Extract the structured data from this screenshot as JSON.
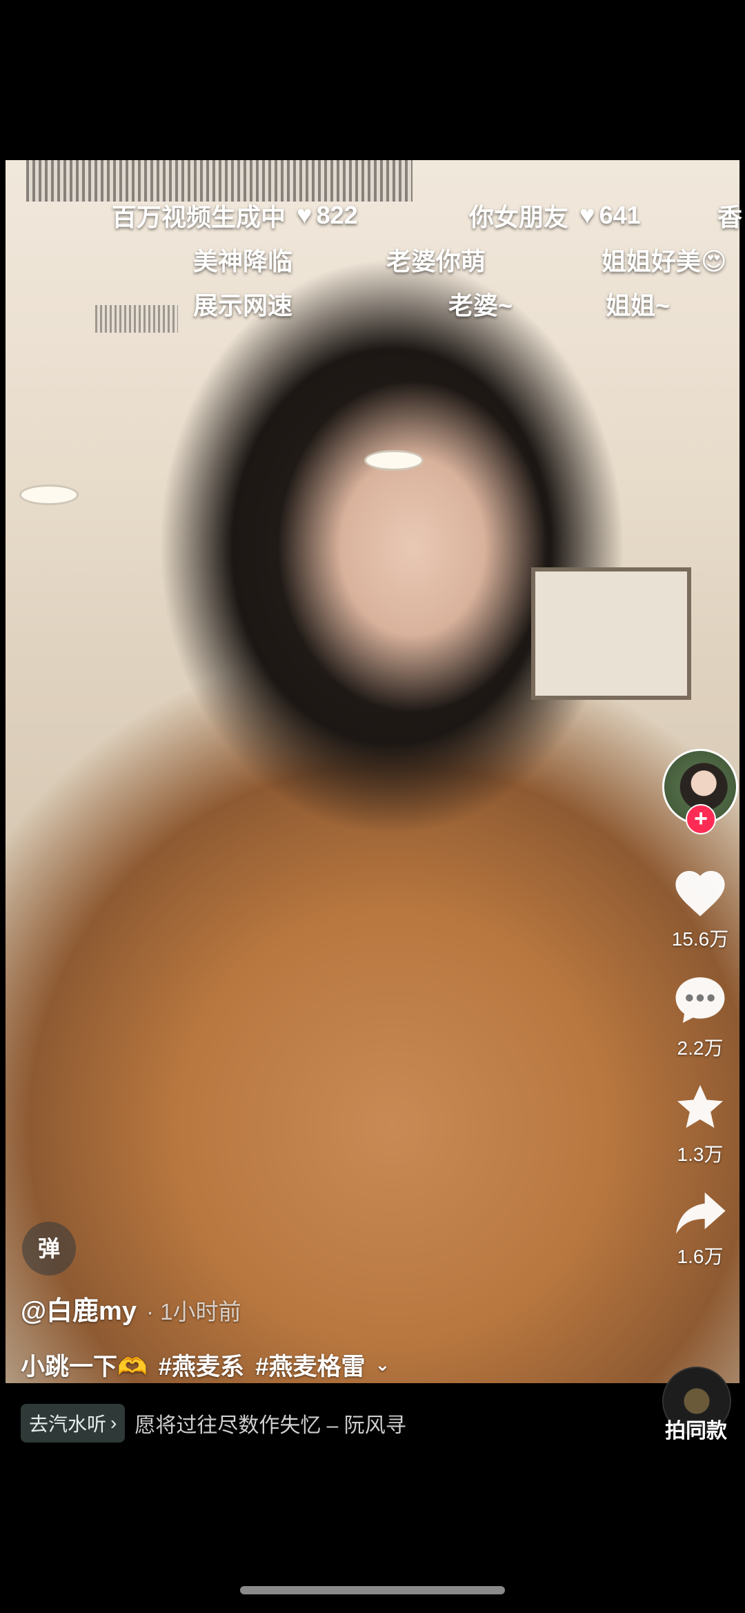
{
  "danmaku": [
    {
      "text": "百万视频生成中",
      "likes": "822"
    },
    {
      "text": "你女朋友",
      "likes": "641"
    },
    {
      "text": "香",
      "likes": ""
    },
    {
      "text": "美神降临"
    },
    {
      "text": "老婆你萌"
    },
    {
      "text": "姐姐好美😍"
    },
    {
      "text": "展示网速"
    },
    {
      "text": "老婆~"
    },
    {
      "text": "姐姐~"
    }
  ],
  "actions": {
    "like_count": "15.6万",
    "comment_count": "2.2万",
    "favorite_count": "1.3万",
    "share_count": "1.6万",
    "follow_symbol": "+"
  },
  "danmaku_toggle_label": "弹",
  "author": {
    "name": "@白鹿my",
    "time": "· 1小时前"
  },
  "caption": {
    "text": "小跳一下🫶",
    "tags": [
      "#燕麦系",
      "#燕麦格雷"
    ],
    "expand_icon": "chevron-down-icon"
  },
  "music": {
    "chip_label": "去汽水听",
    "chip_arrow": "›",
    "title": "愿将过往尽数作失忆 – 阮风寻"
  },
  "remake_label": "拍同款",
  "colors": {
    "follow_red": "#fe2c55",
    "music_chip_bg": "#2f3a38"
  }
}
